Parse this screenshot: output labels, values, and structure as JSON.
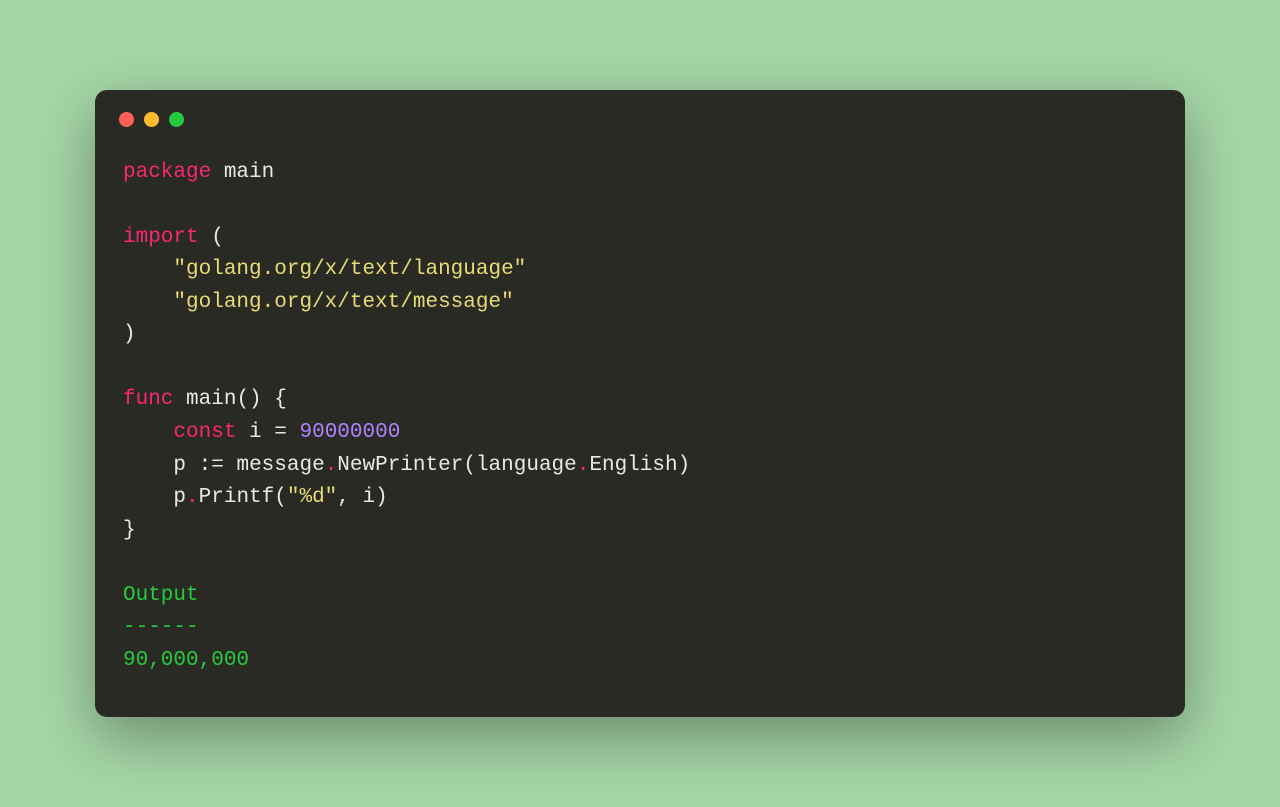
{
  "code": {
    "kw_package": "package",
    "pkgname": "main",
    "kw_import": "import",
    "import1": "\"golang.org/x/text/language\"",
    "import2": "\"golang.org/x/text/message\"",
    "kw_func": "func",
    "funcname": "main",
    "funcparens": "()",
    "lbrace": "{",
    "kw_const": "const",
    "const_var": "i",
    "eq": "=",
    "const_val": "90000000",
    "p_var": "p",
    "walrus": ":=",
    "msg_ident": "message",
    "dot": ".",
    "newprinter": "NewPrinter",
    "lparen": "(",
    "lang_ident": "language",
    "english": "English",
    "rparen": ")",
    "p2": "p",
    "printf": "Printf",
    "fmt_str": "\"%d\"",
    "comma_sp": ", ",
    "i_arg": "i",
    "rbrace": "}",
    "rparen_import": ")",
    "lparen_import": "("
  },
  "output": {
    "label": "Output",
    "sep": "------",
    "value": "90,000,000"
  }
}
